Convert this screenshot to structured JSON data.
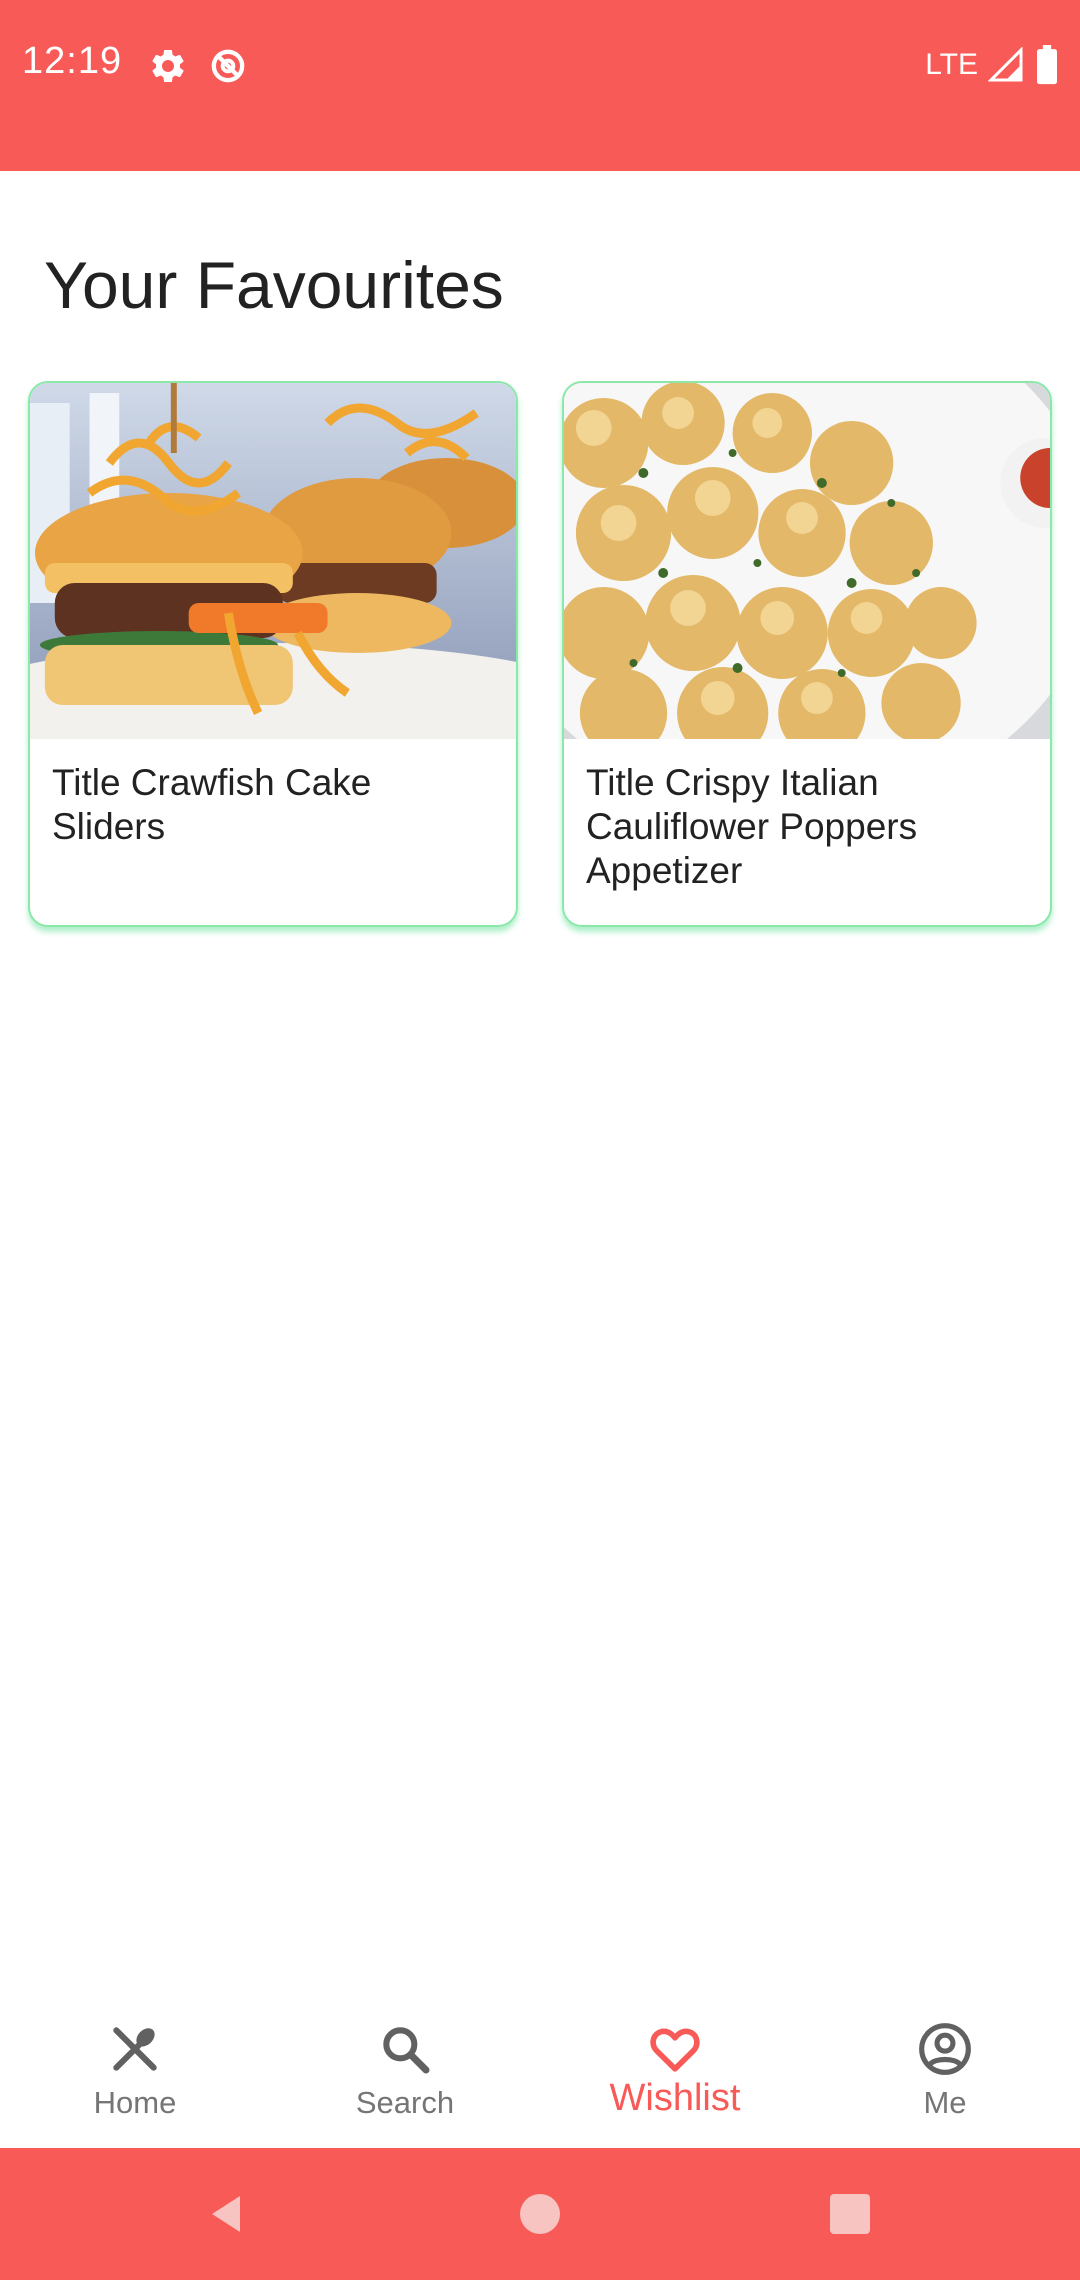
{
  "status_bar": {
    "time": "12:19",
    "network": "LTE",
    "icons": [
      "gear-icon",
      "data-saver-icon",
      "signal-icon",
      "battery-icon"
    ]
  },
  "page": {
    "title": "Your Favourites"
  },
  "favourites": [
    {
      "title": "Title Crawfish Cake Sliders",
      "image": "crawfish-sliders-photo"
    },
    {
      "title": "Title Crispy Italian Cauliflower Poppers Appetizer",
      "image": "cauliflower-poppers-photo"
    }
  ],
  "bottom_nav": {
    "items": [
      {
        "label": "Home",
        "icon": "utensils-icon",
        "active": false
      },
      {
        "label": "Search",
        "icon": "search-icon",
        "active": false
      },
      {
        "label": "Wishlist",
        "icon": "heart-icon",
        "active": true
      },
      {
        "label": "Me",
        "icon": "account-circle-icon",
        "active": false
      }
    ]
  },
  "system_nav": {
    "buttons": [
      "back-icon",
      "home-circle-icon",
      "recents-icon"
    ]
  },
  "colors": {
    "accent": "#F85A57",
    "card_border": "#8CE8A9",
    "text": "#222222",
    "nav_inactive": "#757575"
  }
}
